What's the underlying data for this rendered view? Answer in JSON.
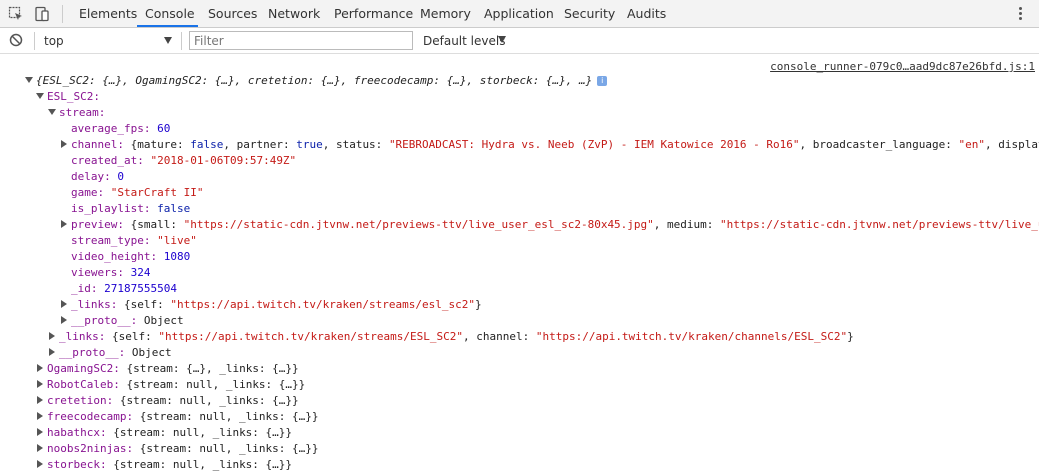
{
  "tabs": {
    "elements": "Elements",
    "console": "Console",
    "sources": "Sources",
    "network": "Network",
    "performance": "Performance",
    "memory": "Memory",
    "application": "Application",
    "security": "Security",
    "audits": "Audits",
    "active": "Console"
  },
  "toolbar": {
    "context": "top",
    "filter_placeholder": "Filter",
    "levels": "Default levels"
  },
  "console": {
    "source_link": "console_runner-079c0…aad9dc87e26bfd.js:1",
    "root_summary": "{ESL_SC2: {…}, OgamingSC2: {…}, cretetion: {…}, freecodecamp: {…}, storbeck: {…}, …}",
    "info_badge": "i",
    "esl_key": "ESL_SC2:",
    "stream_key": "stream:",
    "average_fps": {
      "key": "average_fps:",
      "value": "60"
    },
    "channel": {
      "key": "channel:",
      "open": "{mature: ",
      "mature": "false",
      "partner_label": ", partner: ",
      "partner": "true",
      "status_label": ", status: ",
      "status": "\"REBROADCAST: Hydra vs. Neeb (ZvP) - IEM Katowice 2016 - Ro16\"",
      "lang_label": ", broadcaster_language: ",
      "lang": "\"en\"",
      "display_label": ", display"
    },
    "created_at": {
      "key": "created_at:",
      "value": "\"2018-01-06T09:57:49Z\""
    },
    "delay": {
      "key": "delay:",
      "value": "0"
    },
    "game": {
      "key": "game:",
      "value": "\"StarCraft II\""
    },
    "is_playlist": {
      "key": "is_playlist:",
      "value": "false"
    },
    "preview": {
      "key": "preview:",
      "small_label": "{small: ",
      "small": "\"https://static-cdn.jtvnw.net/previews-ttv/live_user_esl_sc2-80x45.jpg\"",
      "medium_label": ", medium: ",
      "medium": "\"https://static-cdn.jtvnw.net/previews-ttv/live_u"
    },
    "stream_type": {
      "key": "stream_type:",
      "value": "\"live\""
    },
    "video_height": {
      "key": "video_height:",
      "value": "1080"
    },
    "viewers": {
      "key": "viewers:",
      "value": "324"
    },
    "id": {
      "key": "_id:",
      "value": "27187555504"
    },
    "stream_links": {
      "key": "_links:",
      "open": "{self: ",
      "self": "\"https://api.twitch.tv/kraken/streams/esl_sc2\"",
      "close": "}"
    },
    "stream_proto": {
      "key": "__proto__:",
      "value": "Object"
    },
    "esl_links": {
      "key": "_links:",
      "open": "{self: ",
      "self": "\"https://api.twitch.tv/kraken/streams/ESL_SC2\"",
      "channel_label": ", channel: ",
      "channel": "\"https://api.twitch.tv/kraken/channels/ESL_SC2\"",
      "close": "}"
    },
    "esl_proto": {
      "key": "__proto__:",
      "value": "Object"
    },
    "others": [
      {
        "key": "OgamingSC2:",
        "summary": "{stream: {…}, _links: {…}}"
      },
      {
        "key": "RobotCaleb:",
        "summary": "{stream: null, _links: {…}}"
      },
      {
        "key": "cretetion:",
        "summary": "{stream: null, _links: {…}}"
      },
      {
        "key": "freecodecamp:",
        "summary": "{stream: null, _links: {…}}"
      },
      {
        "key": "habathcx:",
        "summary": "{stream: null, _links: {…}}"
      },
      {
        "key": "noobs2ninjas:",
        "summary": "{stream: null, _links: {…}}"
      },
      {
        "key": "storbeck:",
        "summary": "{stream: null, _links: {…}}"
      }
    ]
  }
}
